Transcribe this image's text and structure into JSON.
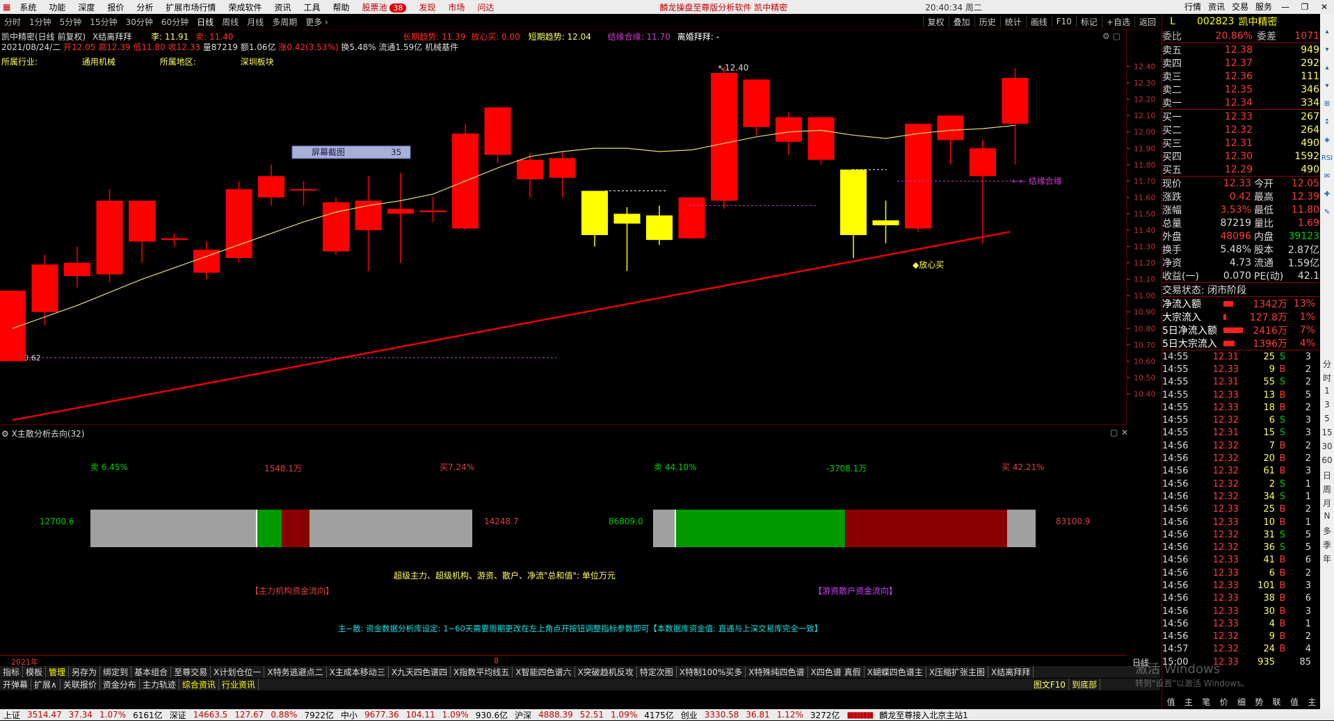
{
  "menu": {
    "items": [
      "系统",
      "功能",
      "深度",
      "报价",
      "分析",
      "扩展市场行情",
      "荣成软件",
      "资讯",
      "工具",
      "帮助"
    ],
    "hot_items": [
      {
        "label": "股票池",
        "badge": "38"
      },
      {
        "label": "发现"
      },
      {
        "label": "市场"
      },
      {
        "label": "问达"
      }
    ],
    "title": "麟龙操盘至尊版分析软件  凯中精密",
    "time": "20:40:34 周二",
    "right_buttons": [
      "行情",
      "资讯",
      "交易",
      "服务"
    ]
  },
  "periods": [
    "分时",
    "1分钟",
    "5分钟",
    "15分钟",
    "30分钟",
    "60分钟",
    "日线",
    "周线",
    "月线",
    "多周期",
    "更多 ›"
  ],
  "active_period": "日线",
  "chart_tools": [
    "复权",
    "叠加",
    "历史",
    "统计",
    "画线",
    "F10",
    "标记",
    "+自选",
    "返回"
  ],
  "info": {
    "stock_title": "凯中精密(日线 前复权)",
    "indicator_name": "X结离拜拜",
    "li": "李: 11.91",
    "mai": "卖: 11.40",
    "trend_long": "长期趋势: 11.39",
    "fangxin": "放心买: 0.00",
    "trend_short": "短期趋势: 12.04",
    "jieyuan": "结缘合缘: 11.70",
    "libai": "离婚拜拜: -",
    "date_line": "2021/08/24/二",
    "kai": "开12.05",
    "gao": "高12.39",
    "di": "低11.80",
    "shou": "收12.33",
    "liang": "量87219",
    "e": "额1.06亿",
    "zhang": "涨0.42(3.53%)",
    "huan": "换5.48%",
    "liutong": "流通1.59亿",
    "board": "机械基件",
    "industry_label": "所属行业:",
    "industry": "通用机械",
    "region_label": "所属地区:",
    "region": "深圳板块"
  },
  "chart_data": {
    "type": "candlestick",
    "y_ticks": [
      "12.40",
      "12.30",
      "12.20",
      "12.10",
      "12.00",
      "11.90",
      "11.80",
      "11.70",
      "11.60",
      "11.50",
      "11.40",
      "11.30",
      "11.20",
      "11.10",
      "11.00",
      "10.90",
      "10.80",
      "10.70",
      "10.60",
      "10.50",
      "10.40"
    ],
    "candles": [
      {
        "o": 10.6,
        "c": 11.03,
        "h": 11.03,
        "l": 10.6,
        "color": "red"
      },
      {
        "o": 10.9,
        "c": 11.19,
        "h": 11.25,
        "l": 10.82,
        "color": "red"
      },
      {
        "o": 11.12,
        "c": 11.2,
        "h": 11.3,
        "l": 11.05,
        "color": "red"
      },
      {
        "o": 11.13,
        "c": 11.58,
        "h": 11.65,
        "l": 11.08,
        "color": "red"
      },
      {
        "o": 11.58,
        "c": 11.33,
        "h": 11.58,
        "l": 11.2,
        "color": "red"
      },
      {
        "o": 11.35,
        "c": 11.34,
        "h": 11.38,
        "l": 11.3,
        "color": "red"
      },
      {
        "o": 11.14,
        "c": 11.28,
        "h": 11.33,
        "l": 11.1,
        "color": "red"
      },
      {
        "o": 11.23,
        "c": 11.65,
        "h": 11.7,
        "l": 11.2,
        "color": "red"
      },
      {
        "o": 11.6,
        "c": 11.73,
        "h": 11.8,
        "l": 11.55,
        "color": "red"
      },
      {
        "o": 11.65,
        "c": 11.65,
        "h": 11.7,
        "l": 11.55,
        "color": "red"
      },
      {
        "o": 11.27,
        "c": 11.57,
        "h": 11.6,
        "l": 11.25,
        "color": "red"
      },
      {
        "o": 11.4,
        "c": 11.58,
        "h": 11.73,
        "l": 11.15,
        "color": "red"
      },
      {
        "o": 11.5,
        "c": 11.53,
        "h": 11.75,
        "l": 11.2,
        "color": "red"
      },
      {
        "o": 11.51,
        "c": 11.52,
        "h": 11.6,
        "l": 11.45,
        "color": "red"
      },
      {
        "o": 11.41,
        "c": 11.99,
        "h": 12.05,
        "l": 11.4,
        "color": "red"
      },
      {
        "o": 11.86,
        "c": 12.15,
        "h": 12.15,
        "l": 11.81,
        "color": "red"
      },
      {
        "o": 11.71,
        "c": 11.83,
        "h": 11.87,
        "l": 11.6,
        "color": "red"
      },
      {
        "o": 11.84,
        "c": 11.72,
        "h": 11.88,
        "l": 11.6,
        "color": "red"
      },
      {
        "o": 11.37,
        "c": 11.64,
        "h": 11.64,
        "l": 11.3,
        "color": "yellow"
      },
      {
        "o": 11.44,
        "c": 11.5,
        "h": 11.54,
        "l": 11.15,
        "color": "yellow"
      },
      {
        "o": 11.34,
        "c": 11.49,
        "h": 11.55,
        "l": 11.31,
        "color": "yellow"
      },
      {
        "o": 11.35,
        "c": 11.6,
        "h": 11.6,
        "l": 11.35,
        "color": "red"
      },
      {
        "o": 11.58,
        "c": 12.36,
        "h": 12.4,
        "l": 11.53,
        "color": "red"
      },
      {
        "o": 12.32,
        "c": 12.03,
        "h": 12.32,
        "l": 11.98,
        "color": "red"
      },
      {
        "o": 12.09,
        "c": 11.94,
        "h": 12.12,
        "l": 11.86,
        "color": "red"
      },
      {
        "o": 12.09,
        "c": 11.83,
        "h": 12.09,
        "l": 11.8,
        "color": "red"
      },
      {
        "o": 11.37,
        "c": 11.77,
        "h": 11.77,
        "l": 11.23,
        "color": "yellow"
      },
      {
        "o": 11.46,
        "c": 11.43,
        "h": 11.58,
        "l": 11.32,
        "color": "yellow"
      },
      {
        "o": 11.41,
        "c": 12.05,
        "h": 12.05,
        "l": 11.39,
        "color": "red"
      },
      {
        "o": 12.1,
        "c": 11.95,
        "h": 12.1,
        "l": 11.8,
        "color": "red"
      },
      {
        "o": 11.73,
        "c": 11.9,
        "h": 11.95,
        "l": 11.32,
        "color": "red"
      },
      {
        "o": 12.05,
        "c": 12.33,
        "h": 12.39,
        "l": 11.8,
        "color": "red"
      }
    ],
    "long_trend": {
      "start": 10.24,
      "end": 11.39
    },
    "short_trend": [
      10.8,
      10.87,
      10.94,
      11.02,
      11.1,
      11.17,
      11.24,
      11.31,
      11.38,
      11.45,
      11.51,
      11.55,
      11.58,
      11.62,
      11.7,
      11.78,
      11.85,
      11.88,
      11.9,
      11.9,
      11.88,
      11.89,
      11.93,
      11.97,
      12.0,
      12.01,
      11.98,
      11.96,
      11.99,
      12.01,
      12.02,
      12.04
    ],
    "annotations": {
      "high_label": "12.40",
      "low_label": "10.62",
      "jieyuan_label": "结缘合缘",
      "fangxin_label": "◆放心买"
    },
    "screenshot_box": {
      "label": "屏幕截图",
      "value": "35"
    }
  },
  "lower": {
    "title": "X主散分析去向(32)",
    "left": {
      "sell": "卖 6.45%",
      "net": "1548.1万",
      "buy": "买7.24%",
      "left_val": "12700.6",
      "right_val": "14248.7",
      "caption": "【主力机构资金流向】"
    },
    "right": {
      "sell": "卖 44.10%",
      "net": "-3708.1万",
      "buy": "买 42.21%",
      "left_val": "86809.0",
      "right_val": "83100.9",
      "caption": "【游资散户资金流向】"
    },
    "center_note": "超级主力、超级机构、游资、散户、净流\"总和值\": 单位万元",
    "footer_note": "主~散: 资金数据分析库设定: 1~60天需要周期更改在左上角点开按钮调整指标参数即可【本数据库资金值: 直通与上深交易库完全一致】"
  },
  "axis_year": "2021年",
  "axis_mark": "8",
  "tabs_row1": [
    "指标",
    "模板",
    "管理",
    "另存为",
    "绑定到",
    "基本组合",
    "至尊交易",
    "X计划仓位一",
    "X特务逃避点二",
    "X主成本移动三",
    "X九天四色谱四",
    "X指数平均线五",
    "X智能四色谱六",
    "X突破趋机反攻",
    "特定次图",
    "X特制100%买多",
    "X特殊纯四色谱",
    "X四色谱 真假",
    "X蝴蝶四色谱主",
    "X压缩扩张主图",
    "X结离拜拜"
  ],
  "tabs_row2": [
    "开弹幕",
    "扩展∧",
    "关联报价",
    "资金分布",
    "主力轨迹",
    "综合资讯",
    "行业资讯"
  ],
  "quote": {
    "code": "002823",
    "name": "凯中精密",
    "weibi_label": "委比",
    "weibi": "20.86%",
    "weicha_label": "委差",
    "weicha": "1071",
    "asks": [
      {
        "l": "卖五",
        "p": "12.38",
        "v": "949"
      },
      {
        "l": "卖四",
        "p": "12.37",
        "v": "292"
      },
      {
        "l": "卖三",
        "p": "12.36",
        "v": "111"
      },
      {
        "l": "卖二",
        "p": "12.35",
        "v": "346"
      },
      {
        "l": "卖一",
        "p": "12.34",
        "v": "334"
      }
    ],
    "bids": [
      {
        "l": "买一",
        "p": "12.33",
        "v": "267"
      },
      {
        "l": "买二",
        "p": "12.32",
        "v": "264"
      },
      {
        "l": "买三",
        "p": "12.31",
        "v": "490"
      },
      {
        "l": "买四",
        "p": "12.30",
        "v": "1592"
      },
      {
        "l": "买五",
        "p": "12.29",
        "v": "490"
      }
    ],
    "stats": [
      {
        "a": "现价",
        "b": "12.33",
        "c": "今开",
        "d": "12.05"
      },
      {
        "a": "涨跌",
        "b": "0.42",
        "c": "最高",
        "d": "12.39"
      },
      {
        "a": "涨幅",
        "b": "3.53%",
        "c": "最低",
        "d": "11.80"
      },
      {
        "a": "总量",
        "b": "87219",
        "c": "量比",
        "d": "1.69"
      },
      {
        "a": "外盘",
        "b": "48096",
        "c": "内盘",
        "d": "39123"
      },
      {
        "a": "换手",
        "b": "5.48%",
        "c": "股本",
        "d": "2.87亿"
      },
      {
        "a": "净资",
        "b": "4.73",
        "c": "流通",
        "d": "1.59亿"
      },
      {
        "a": "收益(一)",
        "b": "0.070",
        "c": "PE(动)",
        "d": "42.1"
      }
    ],
    "trade_state": "交易状态: 闭市阶段",
    "flows": [
      {
        "l": "净流入额",
        "v": "1342万",
        "p": "13%"
      },
      {
        "l": "大宗流入",
        "v": "127.8万",
        "p": "1%"
      },
      {
        "l": "5日净流入额",
        "v": "2416万",
        "p": "7%"
      },
      {
        "l": "5日大宗流入",
        "v": "1396万",
        "p": "4%"
      }
    ],
    "ticks": [
      {
        "t": "14:55",
        "p": "12.31",
        "v": "25",
        "s": "S",
        "n": "3"
      },
      {
        "t": "14:55",
        "p": "12.33",
        "v": "9",
        "s": "B",
        "n": "2"
      },
      {
        "t": "14:55",
        "p": "12.31",
        "v": "55",
        "s": "S",
        "n": "2"
      },
      {
        "t": "14:55",
        "p": "12.33",
        "v": "13",
        "s": "B",
        "n": "5"
      },
      {
        "t": "14:55",
        "p": "12.33",
        "v": "18",
        "s": "B",
        "n": "2"
      },
      {
        "t": "14:55",
        "p": "12.32",
        "v": "6",
        "s": "S",
        "n": "3"
      },
      {
        "t": "14:55",
        "p": "12.31",
        "v": "15",
        "s": "S",
        "n": "3"
      },
      {
        "t": "14:56",
        "p": "12.32",
        "v": "7",
        "s": "B",
        "n": "2"
      },
      {
        "t": "14:56",
        "p": "12.32",
        "v": "20",
        "s": "B",
        "n": "2"
      },
      {
        "t": "14:56",
        "p": "12.32",
        "v": "61",
        "s": "B",
        "n": "3"
      },
      {
        "t": "14:56",
        "p": "12.32",
        "v": "2",
        "s": "S",
        "n": "1"
      },
      {
        "t": "14:56",
        "p": "12.32",
        "v": "34",
        "s": "S",
        "n": "1"
      },
      {
        "t": "14:56",
        "p": "12.33",
        "v": "25",
        "s": "B",
        "n": "2"
      },
      {
        "t": "14:56",
        "p": "12.33",
        "v": "10",
        "s": "B",
        "n": "1"
      },
      {
        "t": "14:56",
        "p": "12.32",
        "v": "31",
        "s": "S",
        "n": "5"
      },
      {
        "t": "14:56",
        "p": "12.32",
        "v": "36",
        "s": "S",
        "n": "5"
      },
      {
        "t": "14:56",
        "p": "12.33",
        "v": "41",
        "s": "B",
        "n": "6"
      },
      {
        "t": "14:56",
        "p": "12.33",
        "v": "6",
        "s": "B",
        "n": "2"
      },
      {
        "t": "14:56",
        "p": "12.33",
        "v": "101",
        "s": "B",
        "n": "3"
      },
      {
        "t": "14:56",
        "p": "12.33",
        "v": "38",
        "s": "B",
        "n": "6"
      },
      {
        "t": "14:56",
        "p": "12.33",
        "v": "30",
        "s": "B",
        "n": "3"
      },
      {
        "t": "14:56",
        "p": "12.33",
        "v": "4",
        "s": "B",
        "n": "1"
      },
      {
        "t": "14:56",
        "p": "12.32",
        "v": "9",
        "s": "B",
        "n": "2"
      },
      {
        "t": "14:57",
        "p": "12.32",
        "v": "24",
        "s": "B",
        "n": "4"
      },
      {
        "t": "15:00",
        "p": "12.33",
        "v": "935",
        "s": "",
        "n": "85"
      }
    ],
    "tick_tabs": [
      "值",
      "主",
      "笔",
      "价",
      "细",
      "势",
      "联",
      "值",
      "主"
    ]
  },
  "side_tools": [
    "分",
    "时",
    "1",
    "3",
    "5",
    "15",
    "30",
    "60",
    "日",
    "周",
    "月",
    "N",
    "多",
    "季",
    "年"
  ],
  "status_bar": {
    "items": [
      {
        "name": "上证",
        "v": "3514.47",
        "c": "37.34",
        "p": "1.07%",
        "a": "6161亿"
      },
      {
        "name": "深证",
        "v": "14663.5",
        "c": "127.67",
        "p": "0.88%",
        "a": "7922亿"
      },
      {
        "name": "中小",
        "v": "9677.36",
        "c": "104.11",
        "p": "1.09%",
        "a": "930.6亿"
      },
      {
        "name": "沪深",
        "v": "4888.39",
        "c": "52.51",
        "p": "1.09%",
        "a": "4175亿"
      },
      {
        "name": "创业",
        "v": "3330.58",
        "c": "36.81",
        "p": "1.12%",
        "a": "3272亿"
      }
    ],
    "server": "麟龙至尊接入北京主站1",
    "watermark1": "激活 Windows",
    "watermark2": "转到\"设置\"以激活 Windows。",
    "lower_buttons": [
      "图文F10",
      "到底部"
    ],
    "flow_tab": "日线"
  },
  "colors": {
    "up": "#ff0000",
    "down": "#00ffff",
    "yellow": "#ffff00",
    "trend": "#e60000",
    "grid": "#3a0000"
  }
}
